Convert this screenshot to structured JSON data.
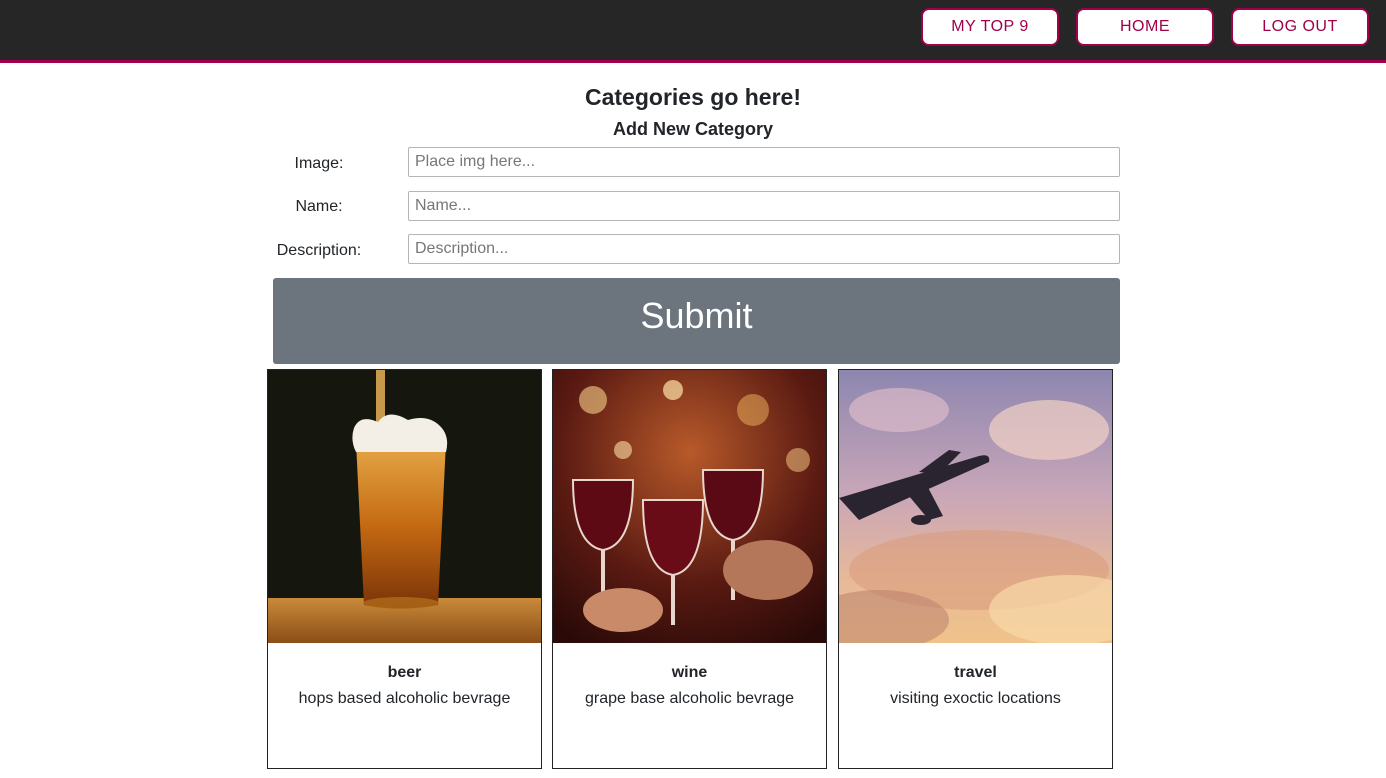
{
  "nav": {
    "top9_label": "MY TOP 9",
    "home_label": "HOME",
    "logout_label": "LOG OUT"
  },
  "page": {
    "title": "Categories go here!",
    "form_title": "Add New Category"
  },
  "form": {
    "image_label": "Image:",
    "image_placeholder": "Place img here...",
    "name_label": "Name:",
    "name_placeholder": "Name...",
    "description_label": "Description:",
    "description_placeholder": "Description...",
    "submit_label": "Submit"
  },
  "categories": [
    {
      "name": "beer",
      "description": "hops based alcoholic bevrage",
      "image_icon": "beer-glass-photo"
    },
    {
      "name": "wine",
      "description": "grape base alcoholic bevrage",
      "image_icon": "wine-glasses-photo"
    },
    {
      "name": "travel",
      "description": "visiting exoctic locations",
      "image_icon": "airplane-sky-photo"
    }
  ],
  "colors": {
    "navbar_bg": "#262626",
    "accent": "#a0004a",
    "submit_bg": "#6c757d"
  }
}
